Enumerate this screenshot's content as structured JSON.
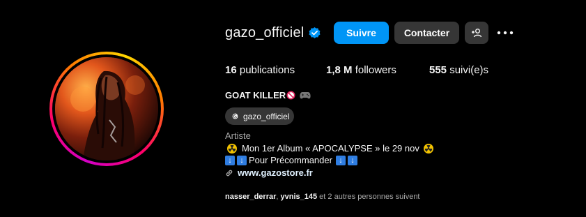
{
  "profile": {
    "username": "gazo_officiel",
    "verified": true,
    "full_name": "GOAT KILLER",
    "category": "Artiste"
  },
  "actions": {
    "follow_label": "Suivre",
    "contact_label": "Contacter",
    "add_user_icon": "add-person-icon",
    "more_icon": "ellipsis-icon"
  },
  "stats": {
    "posts_count": "16",
    "posts_label": "publications",
    "followers_count": "1,8 M",
    "followers_label": "followers",
    "following_count": "555",
    "following_label": "suivi(e)s"
  },
  "threads": {
    "handle": "gazo_officiel"
  },
  "bio": {
    "line1": "Mon 1er Album « APOCALYPSE » le 29 nov",
    "line2": "Pour Précommander",
    "link": "www.gazostore.fr"
  },
  "followed_by": {
    "user1": "nasser_derrar",
    "sep": ", ",
    "user2": "yvnis_145",
    "rest": " et 2 autres personnes suivent"
  },
  "colors": {
    "accent": "#0095f6",
    "button_secondary": "#363636",
    "muted_text": "#a8a8a8",
    "background": "#000000"
  }
}
